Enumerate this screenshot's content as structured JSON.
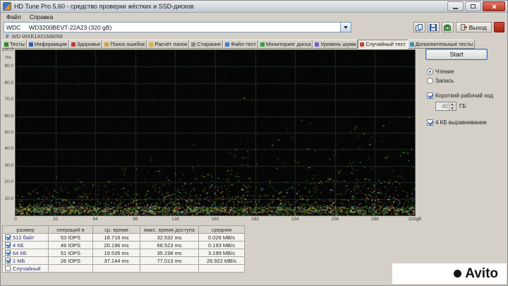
{
  "window": {
    "title": "HD Tune Pro 5.60 - средство проверки жёстких и SSD-дисков"
  },
  "menu": {
    "file": "Файл",
    "help": "Справка"
  },
  "toolbar": {
    "drive_selector": "WDC     WD3200BEVT-22A23 (320 gB)",
    "serial_prefix": "#",
    "serial": "WD-WXE1A51M8058",
    "exit_label": "Выход"
  },
  "tabs": [
    {
      "name": "tests",
      "icon": "tests-icon",
      "color": "#2e8b2e",
      "label": "Тесты",
      "active": false
    },
    {
      "name": "information",
      "icon": "information-icon",
      "color": "#2b5fbf",
      "label": "Информация",
      "active": false
    },
    {
      "name": "health",
      "icon": "health-icon",
      "color": "#cc3333",
      "label": "Здоровье",
      "active": false
    },
    {
      "name": "error-scan",
      "icon": "error-scan-icon",
      "color": "#caa53a",
      "label": "Поиск ошибок",
      "active": false
    },
    {
      "name": "folder-usage",
      "icon": "folder-usage-icon",
      "color": "#d8b13c",
      "label": "Расчёт папок",
      "active": false
    },
    {
      "name": "erase",
      "icon": "erase-icon",
      "color": "#8a8a8a",
      "label": "Стирание",
      "active": false
    },
    {
      "name": "file-test",
      "icon": "file-test-icon",
      "color": "#3a7fd5",
      "label": "Файл-тест",
      "active": false
    },
    {
      "name": "disk-monitor",
      "icon": "disk-monitor-icon",
      "color": "#35a23c",
      "label": "Мониторинг диска",
      "active": false
    },
    {
      "name": "noise-level",
      "icon": "noise-level-icon",
      "color": "#7a5fd0",
      "label": "Уровень шума",
      "active": false
    },
    {
      "name": "random-test",
      "icon": "random-test-icon",
      "color": "#c2452f",
      "label": "Случайный тест",
      "active": true
    },
    {
      "name": "extra-tests",
      "icon": "extra-tests-icon",
      "color": "#3f8fb0",
      "label": "Дополнительные тесты",
      "active": false
    }
  ],
  "chart_data": {
    "type": "scatter",
    "title": "Random access latency scatter",
    "ylabel_unit": "ms",
    "y_ticks": [
      "100.0",
      "90.0",
      "80.0",
      "70.0",
      "60.0",
      "50.0",
      "40.0",
      "30.0",
      "20.0",
      "10.0"
    ],
    "x_ticks": [
      "0",
      "32",
      "64",
      "96",
      "128",
      "160",
      "192",
      "224",
      "256",
      "288",
      "320gB"
    ],
    "y_max_ms": 100,
    "x_max_gb": 320,
    "bg": "#050505",
    "grid_color": "#1e2b1e",
    "palette": [
      "#45c24a",
      "#c8c23c",
      "#d78f33",
      "#cf4633",
      "#3cb8b8",
      "#c05cc0",
      "#d8d8d8"
    ],
    "palette_weights": [
      0.3,
      0.24,
      0.12,
      0.1,
      0.09,
      0.06,
      0.09
    ],
    "points": 3000,
    "noise_points": 9000,
    "seed": 1337
  },
  "side_panel": {
    "start_button": "Start",
    "mode": {
      "read": "Чтение",
      "write": "Запись",
      "selected": "read"
    },
    "short_stroke": {
      "label": "Короткий рабочий ход",
      "checked": true,
      "value": "40",
      "unit": "ГБ"
    },
    "align_4k": {
      "label": "4 КБ выравнивание",
      "checked": true
    }
  },
  "results_table": {
    "headers": [
      "размер",
      "операций в",
      "ср. время",
      "макс. время доступа",
      "средняя"
    ],
    "rows": [
      {
        "checked": true,
        "size": "512 байт",
        "iops": "53 IOPS",
        "avg": "18.716 ms",
        "max": "32.532 ms",
        "speed": "0.026 MB/s"
      },
      {
        "checked": true,
        "size": "4 КБ",
        "iops": "49 IOPS",
        "avg": "20.196 ms",
        "max": "68.523 ms",
        "speed": "0.193 MB/s"
      },
      {
        "checked": true,
        "size": "64 КБ",
        "iops": "51 IOPS",
        "avg": "19.535 ms",
        "max": "35.198 ms",
        "speed": "3.199 MB/s"
      },
      {
        "checked": true,
        "size": "1 МБ",
        "iops": "26 IOPS",
        "avg": "37.144 ms",
        "max": "77.013 ms",
        "speed": "26.922 MB/s"
      },
      {
        "checked": false,
        "size": "Случайный",
        "iops": "",
        "avg": "",
        "max": "",
        "speed": ""
      }
    ]
  },
  "watermark": {
    "text": "Avito"
  }
}
